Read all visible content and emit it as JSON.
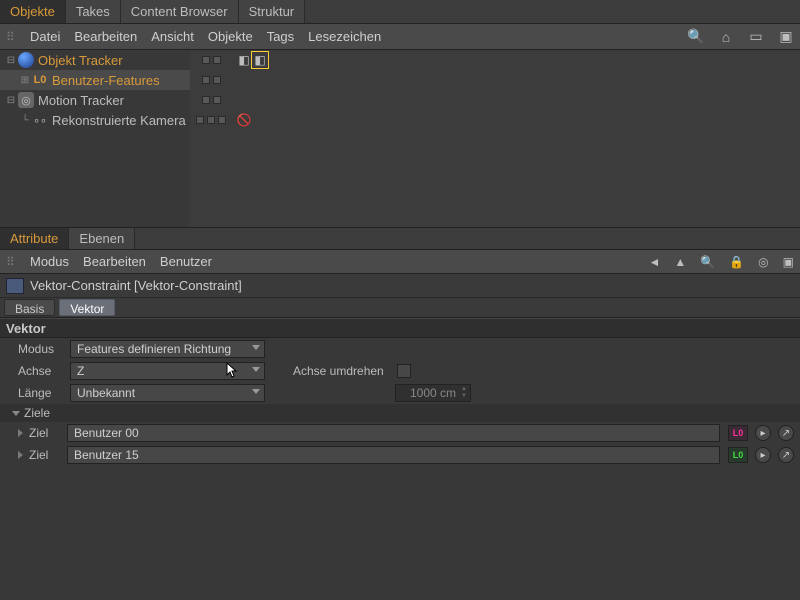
{
  "top_tabs": [
    "Objekte",
    "Takes",
    "Content Browser",
    "Struktur"
  ],
  "top_tabs_active": 0,
  "top_menu": [
    "Datei",
    "Bearbeiten",
    "Ansicht",
    "Objekte",
    "Tags",
    "Lesezeichen"
  ],
  "top_right_icons": [
    "search-icon",
    "home-icon",
    "undock-icon",
    "maximize-icon"
  ],
  "hierarchy": [
    {
      "name": "Objekt Tracker",
      "indent": 0,
      "caret": "minus",
      "color": "orange",
      "icon": "sphere-blue",
      "tags": [
        {
          "name": "tag-a",
          "sel": false
        },
        {
          "name": "tag-b",
          "sel": true
        }
      ],
      "extra_dot": false
    },
    {
      "name": "Benutzer-Features",
      "indent": 1,
      "caret": "plus",
      "color": "orange",
      "icon": "null-orange",
      "tags": [],
      "extra_dot": false,
      "selected": true
    },
    {
      "name": "Motion Tracker",
      "indent": 0,
      "caret": "minus",
      "color": "normal",
      "icon": "tracker-gray",
      "tags": [],
      "extra_dot": false
    },
    {
      "name": "Rekonstruierte Kamera",
      "indent": 1,
      "caret": "leaf",
      "color": "normal",
      "icon": "camera-gray",
      "tags": [
        {
          "name": "stop-icon",
          "sel": false
        }
      ],
      "extra_dot": true
    }
  ],
  "attr_tabs": [
    "Attribute",
    "Ebenen"
  ],
  "attr_tabs_active": 0,
  "attr_menu": [
    "Modus",
    "Bearbeiten",
    "Benutzer"
  ],
  "attr_right_icons": [
    "back-icon",
    "up-arrow-icon",
    "search-icon",
    "lock-icon",
    "target-icon",
    "maximize-icon"
  ],
  "attr_title": "Vektor-Constraint [Vektor-Constraint]",
  "attr_subtabs": [
    "Basis",
    "Vektor"
  ],
  "attr_subtabs_active": 1,
  "section": "Vektor",
  "fields": {
    "modus_label": "Modus",
    "modus_value": "Features definieren Richtung",
    "achse_label": "Achse",
    "achse_value": "Z",
    "achse_umdrehen_label": "Achse umdrehen",
    "laenge_label": "Länge",
    "laenge_value": "Unbekannt",
    "length_num": "1000 cm"
  },
  "ziele": {
    "group_label": "Ziele",
    "row_label": "Ziel",
    "items": [
      {
        "value": "Benutzer 00",
        "badge": "L0",
        "badge_color": "pink"
      },
      {
        "value": "Benutzer 15",
        "badge": "L0",
        "badge_color": "green"
      }
    ]
  }
}
